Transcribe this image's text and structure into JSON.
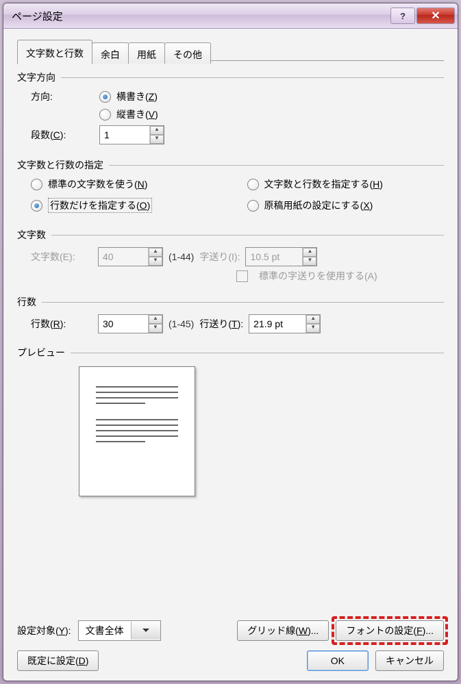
{
  "title": "ページ設定",
  "tabs": [
    "文字数と行数",
    "余白",
    "用紙",
    "その他"
  ],
  "active_tab": 0,
  "sec_direction": {
    "header": "文字方向",
    "label_direction": "方向:",
    "opt_horizontal": "横書き(Z)",
    "opt_vertical": "縦書き(V)",
    "label_columns": "段数(C):",
    "columns_value": "1"
  },
  "sec_spec": {
    "header": "文字数と行数の指定",
    "opt_std": "標準の文字数を使う(N)",
    "opt_chars_lines": "文字数と行数を指定する(H)",
    "opt_lines_only": "行数だけを指定する(O)",
    "opt_grid": "原稿用紙の設定にする(X)"
  },
  "sec_chars": {
    "header": "文字数",
    "label_chars": "文字数(E):",
    "chars_value": "40",
    "chars_range": "(1-44)",
    "label_pitch": "字送り(I):",
    "pitch_value": "10.5 pt",
    "chk_std_pitch": "標準の字送りを使用する(A)"
  },
  "sec_lines": {
    "header": "行数",
    "label_lines": "行数(R):",
    "lines_value": "30",
    "lines_range": "(1-45)",
    "label_linepitch": "行送り(T):",
    "linepitch_value": "21.9 pt"
  },
  "sec_preview": {
    "header": "プレビュー"
  },
  "bottom": {
    "label_apply": "設定対象(Y):",
    "apply_value": "文書全体",
    "btn_grid": "グリッド線(W)...",
    "btn_font": "フォントの設定(F)..."
  },
  "dlg": {
    "btn_default": "既定に設定(D)",
    "btn_ok": "OK",
    "btn_cancel": "キャンセル"
  }
}
